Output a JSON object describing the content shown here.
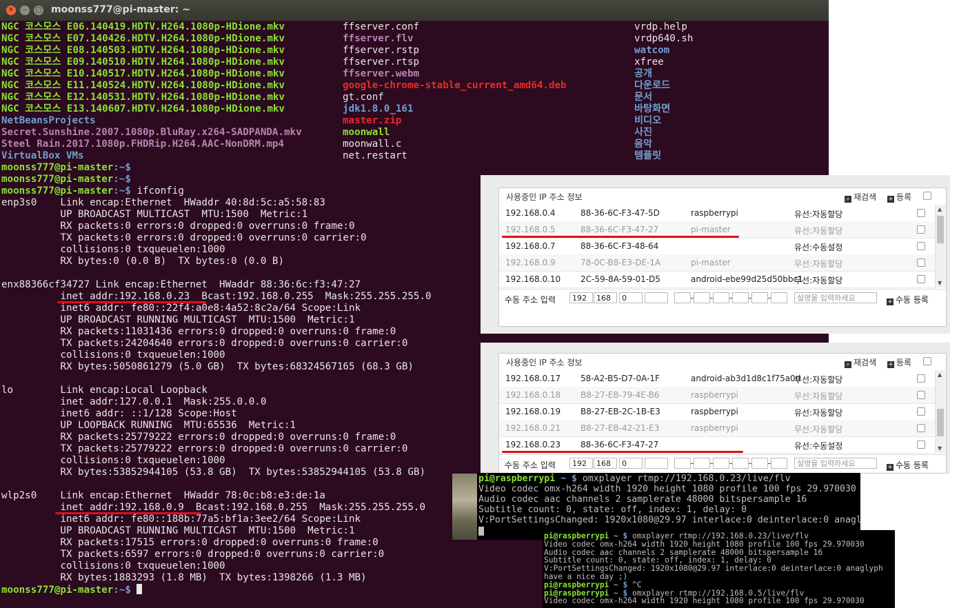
{
  "window": {
    "title": "moonss777@pi-master: ~"
  },
  "ls_columns": [
    [
      {
        "text": "NGC 코스모스 E06.140419.HDTV.H264.1080p-HDione.mkv",
        "color": "green"
      },
      {
        "text": "NGC 코스모스 E07.140426.HDTV.H264.1080p-HDione.mkv",
        "color": "green"
      },
      {
        "text": "NGC 코스모스 E08.140503.HDTV.H264.1080p-HDione.mkv",
        "color": "green"
      },
      {
        "text": "NGC 코스모스 E09.140510.HDTV.H264.1080p-HDione.mkv",
        "color": "green"
      },
      {
        "text": "NGC 코스모스 E10.140517.HDTV.H264.1080p-HDione.mkv",
        "color": "green"
      },
      {
        "text": "NGC 코스모스 E11.140524.HDTV.H264.1080p-HDione.mkv",
        "color": "green"
      },
      {
        "text": "NGC 코스모스 E12.140531.HDTV.H264.1080p-HDione.mkv",
        "color": "green"
      },
      {
        "text": "NGC 코스모스 E13.140607.HDTV.H264.1080p-HDione.mkv",
        "color": "green"
      },
      {
        "text": "NetBeansProjects",
        "color": "dir"
      },
      {
        "text": "Secret.Sunshine.2007.1080p.BluRay.x264-SADPANDA.mkv",
        "color": "mkv"
      },
      {
        "text": "Steel Rain.2017.1080p.FHDRip.H264.AAC-NonDRM.mp4",
        "color": "mkv"
      },
      {
        "text": "VirtualBox VMs",
        "color": "dir"
      }
    ],
    [
      {
        "text": "ffserver.conf",
        "color": "plain"
      },
      {
        "text": "ffserver.flv",
        "color": "mkv"
      },
      {
        "text": "ffserver.rstp",
        "color": "plain"
      },
      {
        "text": "ffserver.rtsp",
        "color": "plain"
      },
      {
        "text": "ffserver.webm",
        "color": "mkv"
      },
      {
        "text": "google-chrome-stable_current_amd64.deb",
        "color": "red"
      },
      {
        "text": "gt.conf",
        "color": "plain"
      },
      {
        "text": "jdk1.8.0_161",
        "color": "dir"
      },
      {
        "text": "master.zip",
        "color": "red"
      },
      {
        "text": "moonwall",
        "color": "green"
      },
      {
        "text": "moonwall.c",
        "color": "plain"
      },
      {
        "text": "net.restart",
        "color": "plain"
      }
    ],
    [
      {
        "text": "vrdp.help",
        "color": "plain"
      },
      {
        "text": "vrdp640.sh",
        "color": "plain"
      },
      {
        "text": "watcom",
        "color": "dir"
      },
      {
        "text": "xfree",
        "color": "plain"
      },
      {
        "text": "공개",
        "color": "dir"
      },
      {
        "text": "다운로드",
        "color": "dir"
      },
      {
        "text": "문서",
        "color": "dir"
      },
      {
        "text": "바탕화면",
        "color": "dir"
      },
      {
        "text": "비디오",
        "color": "dir"
      },
      {
        "text": "사진",
        "color": "dir"
      },
      {
        "text": "음악",
        "color": "dir"
      },
      {
        "text": "템플릿",
        "color": "dir"
      }
    ]
  ],
  "prompt": {
    "user": "moonss777@pi-master",
    "path": ":~$"
  },
  "commands": {
    "ifconfig": " ifconfig"
  },
  "output": [
    "enp3s0    Link encap:Ethernet  HWaddr 40:8d:5c:a5:58:83",
    "          UP BROADCAST MULTICAST  MTU:1500  Metric:1",
    "          RX packets:0 errors:0 dropped:0 overruns:0 frame:0",
    "          TX packets:0 errors:0 dropped:0 overruns:0 carrier:0",
    "          collisions:0 txqueuelen:1000",
    "          RX bytes:0 (0.0 B)  TX bytes:0 (0.0 B)",
    "",
    "enx88366cf34727 Link encap:Ethernet  HWaddr 88:36:6c:f3:47:27",
    "          inet addr:192.168.0.23  Bcast:192.168.0.255  Mask:255.255.255.0",
    "          inet6 addr: fe80::22f4:a0e8:4a52:8c2a/64 Scope:Link",
    "          UP BROADCAST RUNNING MULTICAST  MTU:1500  Metric:1",
    "          RX packets:11031436 errors:0 dropped:0 overruns:0 frame:0",
    "          TX packets:24204640 errors:0 dropped:0 overruns:0 carrier:0",
    "          collisions:0 txqueuelen:1000",
    "          RX bytes:5050861279 (5.0 GB)  TX bytes:68324567165 (68.3 GB)",
    "",
    "lo        Link encap:Local Loopback",
    "          inet addr:127.0.0.1  Mask:255.0.0.0",
    "          inet6 addr: ::1/128 Scope:Host",
    "          UP LOOPBACK RUNNING  MTU:65536  Metric:1",
    "          RX packets:25779222 errors:0 dropped:0 overruns:0 frame:0",
    "          TX packets:25779222 errors:0 dropped:0 overruns:0 carrier:0",
    "          collisions:0 txqueuelen:1000",
    "          RX bytes:53852944105 (53.8 GB)  TX bytes:53852944105 (53.8 GB)",
    "",
    "wlp2s0    Link encap:Ethernet  HWaddr 78:0c:b8:e3:de:1a",
    "          inet addr:192.168.0.9  Bcast:192.168.0.255  Mask:255.255.255.0",
    "          inet6 addr: fe80::188b:77a5:bf1a:3ee2/64 Scope:Link",
    "          UP BROADCAST RUNNING MULTICAST  MTU:1500  Metric:1",
    "          RX packets:17515 errors:0 dropped:0 overruns:0 frame:0",
    "          TX packets:6597 errors:0 dropped:0 overruns:0 carrier:0",
    "          collisions:0 txqueuelen:1000",
    "          RX bytes:1883293 (1.8 MB)  TX bytes:1398266 (1.3 MB)"
  ],
  "panel_top": {
    "title": "사용중인 IP 주소 정보",
    "recheck": "재검색",
    "register": "등록",
    "rows": [
      {
        "ip": "192.168.0.4",
        "mac": "88-36-6C-F3-47-5D",
        "name": "raspberrypi",
        "type": "유선:자동할당",
        "off": false
      },
      {
        "ip": "192.168.0.5",
        "mac": "88-36-6C-F3-47-27",
        "name": "pi-master",
        "type": "유선:자동할당",
        "off": true
      },
      {
        "ip": "192.168.0.7",
        "mac": "88-36-6C-F3-48-64",
        "name": "",
        "type": "유선:수동설정",
        "off": false
      },
      {
        "ip": "192.168.0.9",
        "mac": "78-0C-B8-E3-DE-1A",
        "name": "pi-master",
        "type": "무선:자동할당",
        "off": true
      },
      {
        "ip": "192.168.0.10",
        "mac": "2C-59-8A-59-01-D5",
        "name": "android-ebe99d25d50bbc1",
        "type": "무선:자동할당",
        "off": false
      }
    ],
    "manual_label": "수동 주소 입력",
    "ip_parts": [
      "192",
      "168",
      "0",
      ""
    ],
    "desc_placeholder": "설명을 입력하세요",
    "manual_register": "수동 등록"
  },
  "panel_bottom": {
    "title": "사용중인 IP 주소 정보",
    "recheck": "재검색",
    "register": "등록",
    "rows": [
      {
        "ip": "192.168.0.17",
        "mac": "58-A2-B5-D7-0A-1F",
        "name": "android-ab3d1d8c1f75a0d",
        "type": "무선:자동할당",
        "off": false
      },
      {
        "ip": "192.168.0.18",
        "mac": "B8-27-EB-79-4E-B6",
        "name": "raspberrypi",
        "type": "무선:자동할당",
        "off": true
      },
      {
        "ip": "192.168.0.19",
        "mac": "B8-27-EB-2C-1B-E3",
        "name": "raspberrypi",
        "type": "유선:자동할당",
        "off": false
      },
      {
        "ip": "192.168.0.21",
        "mac": "B8-27-EB-42-21-E3",
        "name": "raspberrypi",
        "type": "무선:자동할당",
        "off": true
      },
      {
        "ip": "192.168.0.23",
        "mac": "88-36-6C-F3-47-27",
        "name": "",
        "type": "유선:수동설정",
        "off": false
      }
    ],
    "manual_label": "수동 주소 입력",
    "ip_parts": [
      "192",
      "168",
      "0",
      ""
    ],
    "desc_placeholder": "설명을 입력하세요",
    "manual_register": "수동 등록"
  },
  "pi_term_1": {
    "user": "pi@raspberrypi",
    "path": " ~ $",
    "cmd": " omxplayer rtmp://192.168.0.23/live/flv",
    "lines": [
      "Video codec omx-h264 width 1920 height 1080 profile 100 fps 29.970030",
      "Audio codec aac channels 2 samplerate 48000 bitspersample 16",
      "Subtitle count: 0, state: off, index: 1, delay: 0",
      "V:PortSettingsChanged: 1920x1080@29.97 interlace:0 deinterlace:0 anagl"
    ]
  },
  "pi_term_2": {
    "user": "pi@raspberrypi",
    "path": " ~ $",
    "cmd1": " omxplayer rtmp://192.168.0.23/live/flv",
    "lines": [
      "Video codec omx-h264 width 1920 height 1080 profile 100 fps 29.970030",
      "Audio codec aac channels 2 samplerate 48000 bitspersample 16",
      "Subtitle count: 0, state: off, index: 1, delay: 0",
      "V:PortSettingsChanged: 1920x1080@29.97 interlace:0 deinterlace:0 anaglyph",
      "have a nice day ;)"
    ],
    "cmd2": " ^C",
    "cmd3": " omxplayer rtmp://192.168.0.5/live/flv",
    "last": "Video codec omx-h264 width 1920 height 1080 profile 100 fps 29.970030"
  },
  "colors": {
    "accent": "#e0101a",
    "terminal_bg": "#2c0a1f",
    "green": "#8ae234",
    "blue": "#729fcf"
  }
}
